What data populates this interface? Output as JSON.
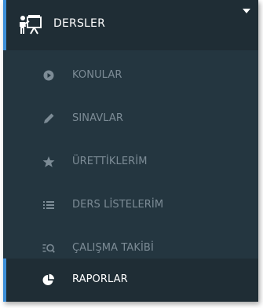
{
  "menu": {
    "header": {
      "label": "DERSLER",
      "icon": "teacher-board-icon"
    },
    "items": [
      {
        "label": "KONULAR",
        "icon": "play-circle-icon",
        "active": false
      },
      {
        "label": "SINAVLAR",
        "icon": "pencil-icon",
        "active": false
      },
      {
        "label": "ÜRETTİKLERİM",
        "icon": "star-icon",
        "active": false
      },
      {
        "label": "DERS LİSTELERİM",
        "icon": "list-icon",
        "active": false
      },
      {
        "label": "ÇALIŞMA TAKİBİ",
        "icon": "search-list-icon",
        "active": false
      },
      {
        "label": "RAPORLAR",
        "icon": "pie-chart-icon",
        "active": true
      }
    ]
  },
  "colors": {
    "background": "#243640",
    "header_background": "#1f2d35",
    "accent": "#3d8fd8",
    "inactive_text": "#7d8c96",
    "active_text": "#ffffff"
  }
}
